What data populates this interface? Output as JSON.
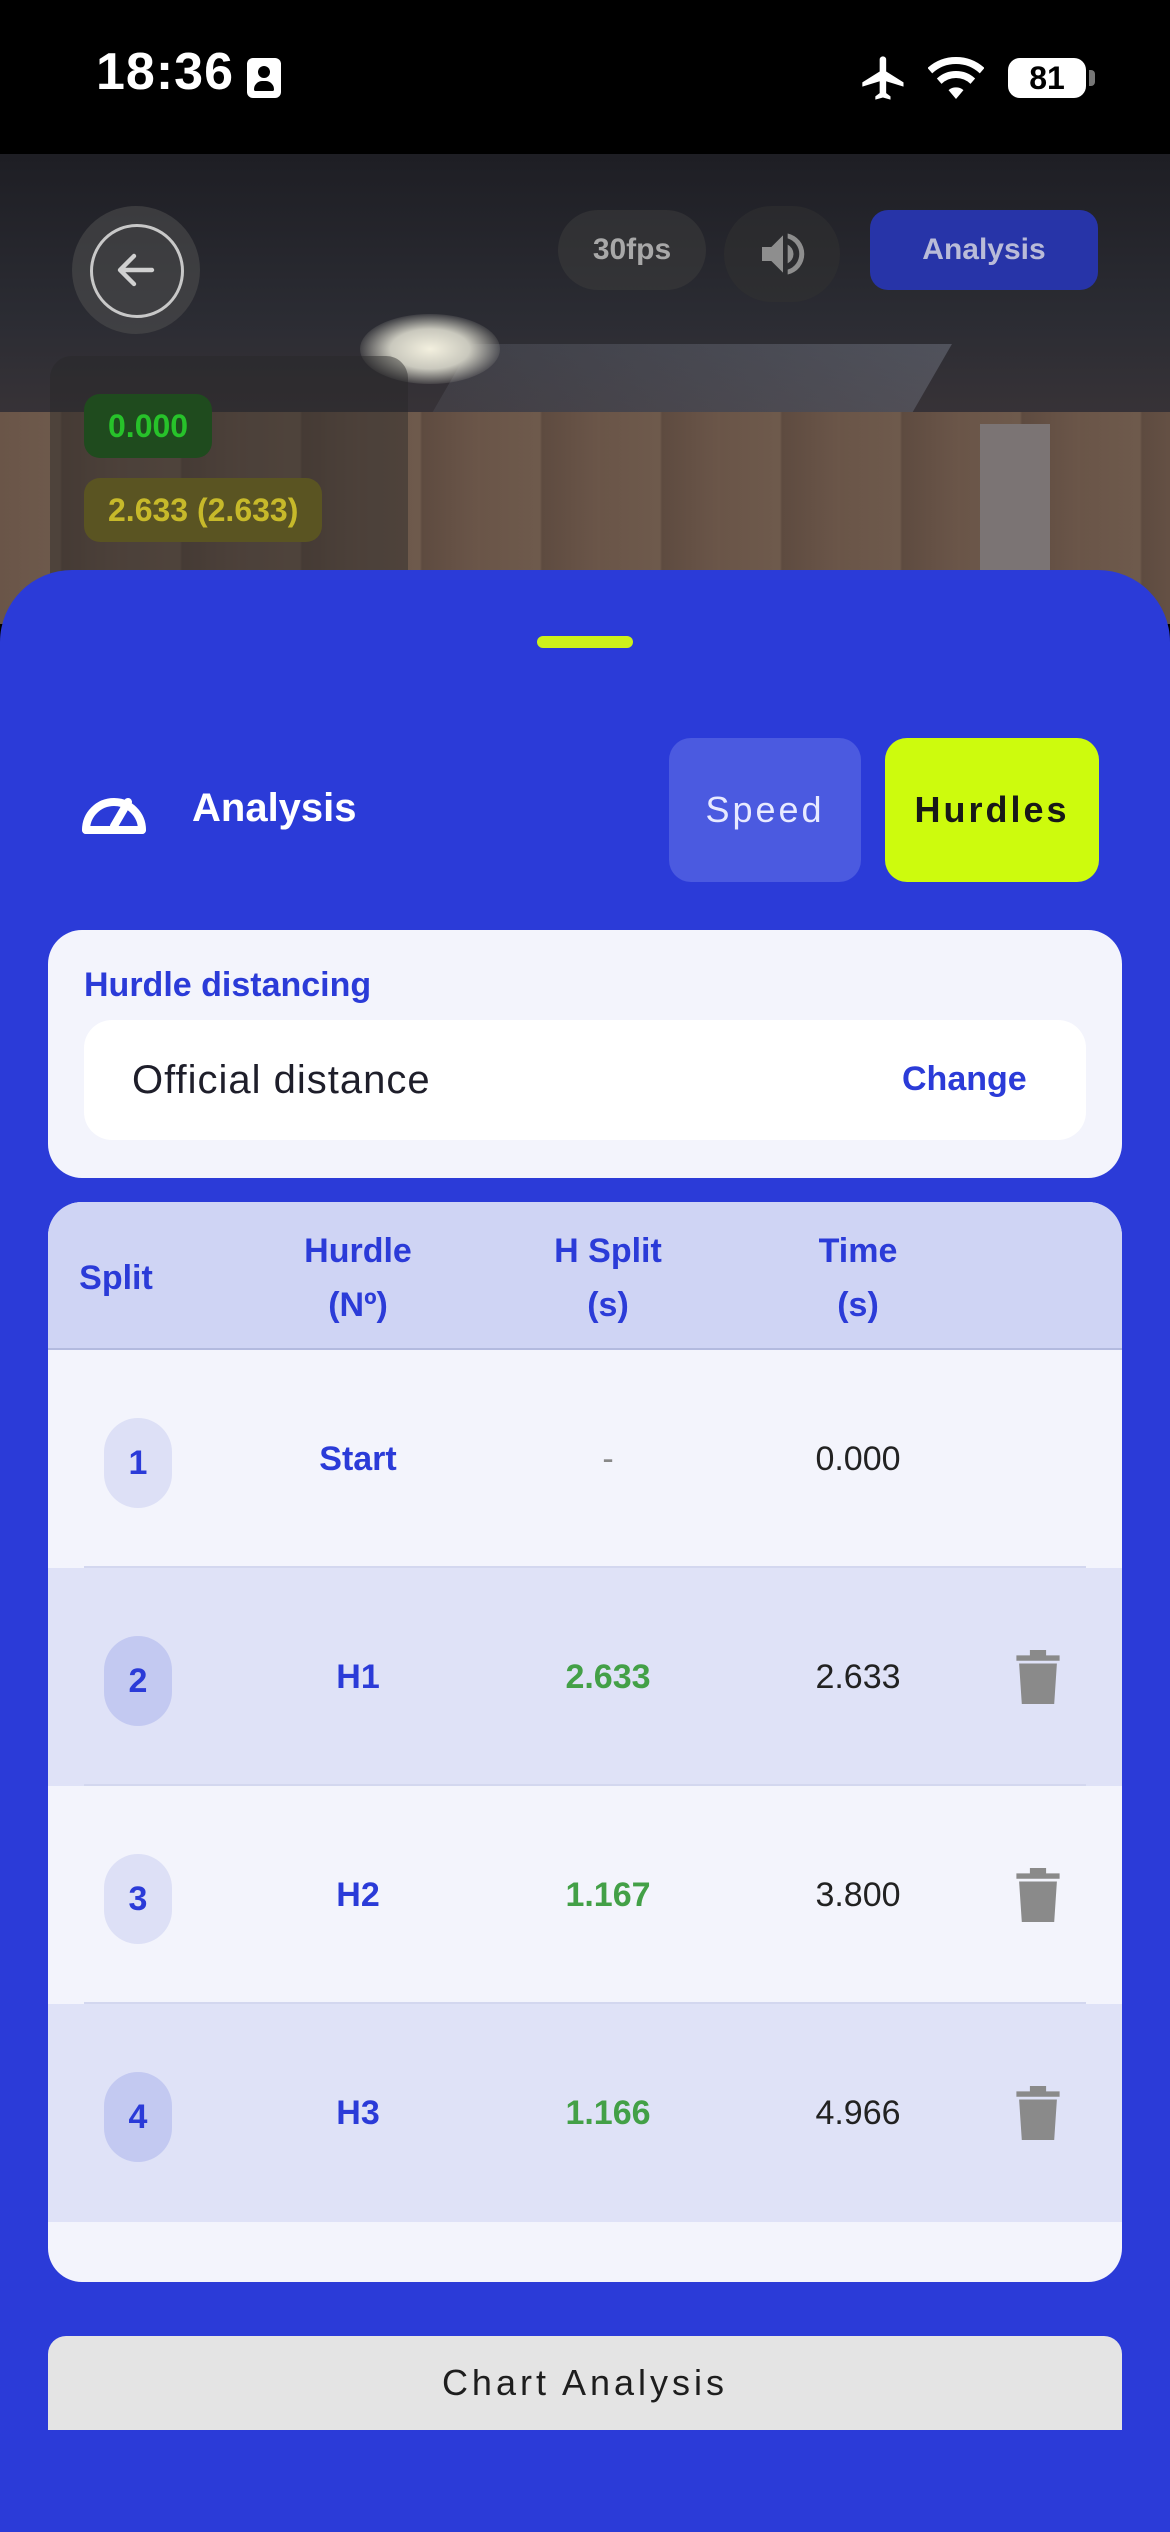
{
  "status_bar": {
    "time": "18:36",
    "battery": "81"
  },
  "camera": {
    "fps": "30fps",
    "analysis_button": "Analysis",
    "time_tags": [
      "0.000",
      "2.633 (2.633)"
    ]
  },
  "sheet": {
    "title": "Analysis",
    "segments": {
      "speed": "Speed",
      "hurdles": "Hurdles"
    },
    "accent_color": "#cdfb0d",
    "brand_color": "#2b3bd8"
  },
  "distancing": {
    "label": "Hurdle distancing",
    "value": "Official distance",
    "change": "Change"
  },
  "table": {
    "headers": {
      "split": "Split",
      "hurdle_1": "Hurdle",
      "hurdle_2": "(Nº)",
      "hsplit_1": "H Split",
      "hsplit_2": "(s)",
      "time_1": "Time",
      "time_2": "(s)"
    },
    "rows": [
      {
        "split": "1",
        "hurdle": "Start",
        "h_split": "-",
        "time": "0.000"
      },
      {
        "split": "2",
        "hurdle": "H1",
        "h_split": "2.633",
        "time": "2.633"
      },
      {
        "split": "3",
        "hurdle": "H2",
        "h_split": "1.167",
        "time": "3.800"
      },
      {
        "split": "4",
        "hurdle": "H3",
        "h_split": "1.166",
        "time": "4.966"
      }
    ]
  },
  "chart_button": "Chart Analysis"
}
